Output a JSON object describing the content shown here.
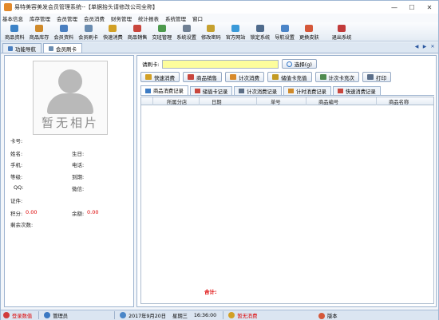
{
  "window": {
    "title": "易特美容美发会员管理系统--【单据抬头请修改公司全称】",
    "controls": [
      "—",
      "☐",
      "✕"
    ]
  },
  "menu": [
    "基本信息",
    "库存管理",
    "会员管理",
    "会员消费",
    "财务管理",
    "统计报表",
    "系统管理",
    "窗口"
  ],
  "toolbar": [
    {
      "label": "商品资料",
      "color": "#3d83c7"
    },
    {
      "label": "商品库存",
      "color": "#d08a2a"
    },
    {
      "label": "会员资料",
      "color": "#4a7fc0"
    },
    {
      "label": "会员刷卡",
      "color": "#6a8cb0"
    },
    {
      "label": "快速消费",
      "color": "#d2a025"
    },
    {
      "label": "商品销售",
      "color": "#c9463d"
    },
    {
      "label": "交班管理",
      "color": "#4d9a4d"
    },
    {
      "label": "系统设置",
      "color": "#6f7f93"
    },
    {
      "label": "修改密码",
      "color": "#c6a12f"
    },
    {
      "label": "官方网站",
      "color": "#3a9ad9"
    },
    {
      "label": "锁定系统",
      "color": "#4f6b8c"
    },
    {
      "label": "导航设置",
      "color": "#4b85c8"
    },
    {
      "label": "更换皮肤",
      "color": "#d5583a"
    },
    {
      "label": "退出系统",
      "color": "#c23b3b"
    }
  ],
  "page_tabs": [
    {
      "label": "功能导航",
      "active": false
    },
    {
      "label": "会员刷卡",
      "active": true
    }
  ],
  "tab_controls": [
    "◀",
    "▶",
    "✕"
  ],
  "photo": {
    "placeholder": "暂无相片"
  },
  "member": {
    "card_no_label": "卡号:",
    "name_label": "姓名:",
    "birthday_label": "生日:",
    "mobile_label": "手机:",
    "phone_label": "电话:",
    "level_label": "等级:",
    "expiry_label": "到期:",
    "qq_label": "QQ:",
    "wechat_label": "微信:",
    "cert_label": "证件:",
    "points_label": "积分:",
    "points_value": "0.00",
    "balance_label": "余额:",
    "balance_value": "0.00",
    "remaining_label": "剩余次数:"
  },
  "card_input": {
    "label": "请刷卡:",
    "value": "",
    "select_button": "选择(g)"
  },
  "actions": [
    {
      "label": "快速消费",
      "color": "#d2a025"
    },
    {
      "label": "商品销售",
      "color": "#c9463d"
    },
    {
      "label": "计次消费",
      "color": "#d88a2a"
    },
    {
      "label": "储值卡充值",
      "color": "#c39a22"
    },
    {
      "label": "计次卡充次",
      "color": "#4f8b4f"
    },
    {
      "label": "打印",
      "color": "#5b6f8a"
    }
  ],
  "sub_tabs": [
    {
      "label": "商品消费记录",
      "active": true,
      "color": "#3c7bc4"
    },
    {
      "label": "储值卡记录",
      "active": false,
      "color": "#c9463d"
    },
    {
      "label": "计次消费记录",
      "active": false,
      "color": "#5d6f86"
    },
    {
      "label": "计时消费记录",
      "active": false,
      "color": "#d08a2a"
    },
    {
      "label": "快速消费记录",
      "active": false,
      "color": "#c9463d"
    }
  ],
  "table": {
    "columns": [
      "所属分店",
      "日期",
      "单号",
      "商品编号",
      "商品名称"
    ],
    "rows": []
  },
  "total_label": "合计:",
  "status": {
    "login_status": "登录数值",
    "user": "管理员",
    "date": "2017年9月20日",
    "weekday": "星期三",
    "time": "16:36:00",
    "quick_consume": "暂无消费",
    "version": "版本"
  }
}
